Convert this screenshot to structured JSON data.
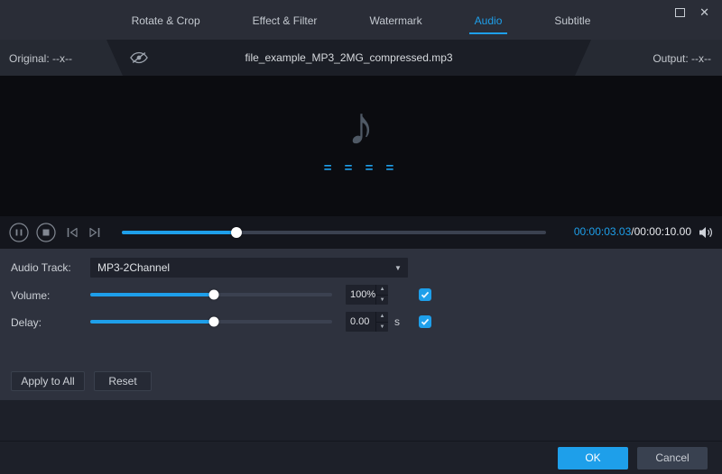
{
  "window": {
    "controls": {
      "close": "✕"
    }
  },
  "tabs": [
    {
      "label": "Rotate & Crop",
      "active": false
    },
    {
      "label": "Effect & Filter",
      "active": false
    },
    {
      "label": "Watermark",
      "active": false
    },
    {
      "label": "Audio",
      "active": true
    },
    {
      "label": "Subtitle",
      "active": false
    }
  ],
  "info_bar": {
    "original": "Original: --x--",
    "filename": "file_example_MP3_2MG_compressed.mp3",
    "output": "Output: --x--"
  },
  "preview": {
    "note_glyph": "♪",
    "loading_text": "= = = ="
  },
  "player": {
    "seek_percent": 27,
    "time_current": "00:00:03.03",
    "time_total": "/00:00:10.00"
  },
  "panel": {
    "audio_track_label": "Audio Track:",
    "audio_track_value": "MP3-2Channel",
    "volume_label": "Volume:",
    "volume_value": "100%",
    "volume_percent": 51,
    "delay_label": "Delay:",
    "delay_value": "0.00",
    "delay_unit": "s",
    "delay_percent": 51,
    "apply_all_label": "Apply to All",
    "reset_label": "Reset"
  },
  "footer": {
    "ok_label": "OK",
    "cancel_label": "Cancel"
  },
  "icons": {
    "chevron_down": "▼",
    "spinner_up": "▲",
    "spinner_down": "▼",
    "close": "✕"
  },
  "colors": {
    "accent": "#1e9fea"
  }
}
